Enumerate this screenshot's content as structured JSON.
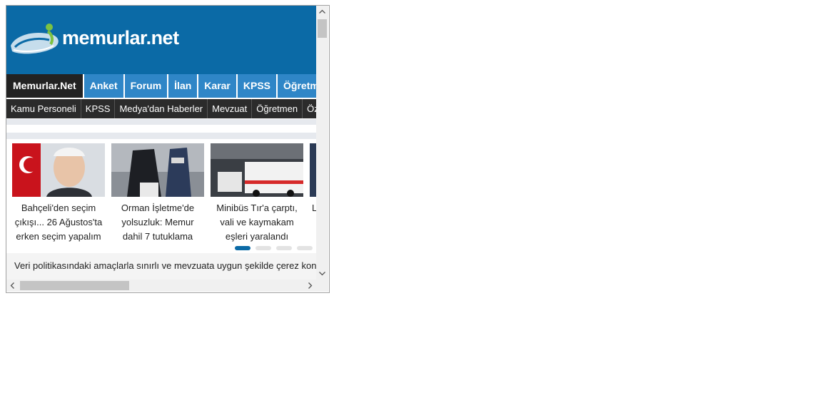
{
  "site": {
    "logo_text": "memurlar.net",
    "brand_color": "#0b6aa6"
  },
  "nav_primary": [
    {
      "label": "Memurlar.Net",
      "active": true
    },
    {
      "label": "Anket"
    },
    {
      "label": "Forum"
    },
    {
      "label": "İlan"
    },
    {
      "label": "Karar"
    },
    {
      "label": "KPSS"
    },
    {
      "label": "Öğretmen"
    }
  ],
  "nav_secondary": [
    {
      "label": "Kamu Personeli"
    },
    {
      "label": "KPSS"
    },
    {
      "label": "Medya'dan Haberler"
    },
    {
      "label": "Mevzuat"
    },
    {
      "label": "Öğretmen"
    },
    {
      "label": "Özel"
    }
  ],
  "news": [
    {
      "caption": "Bahçeli'den seçim çıkışı... 26 Ağustos'ta erken seçim yapalım",
      "image_icon": "portrait-photo"
    },
    {
      "caption": "Orman İşletme'de yolsuzluk: Memur dahil 7 tutuklama",
      "image_icon": "police-photo"
    },
    {
      "caption": "Minibüs Tır'a çarptı, vali ve kaymakam eşleri yaralandı",
      "image_icon": "ambulance-photo"
    },
    {
      "caption": "L",
      "image_icon": "news-photo"
    }
  ],
  "slider": {
    "active_index": 0,
    "count": 4
  },
  "cookie_notice": {
    "text": "Veri politikasındaki amaçlarla sınırlı ve mevzuata uygun şekilde çerez konu"
  },
  "scrollbars": {
    "up_icon": "chevron-up-icon",
    "down_icon": "chevron-down-icon",
    "left_icon": "chevron-left-icon",
    "right_icon": "chevron-right-icon"
  }
}
